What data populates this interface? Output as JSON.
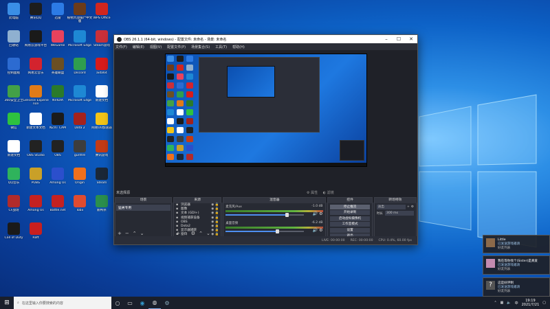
{
  "desktop_icons": [
    {
      "label": "此电脑",
      "color": "#3a8ee6"
    },
    {
      "label": "腾讯QQ",
      "color": "#1d1d1d"
    },
    {
      "label": "迅雷",
      "color": "#2c7be5"
    },
    {
      "label": "植物大战僵尸中文版",
      "color": "#6b3b1a"
    },
    {
      "label": "WPS Office",
      "color": "#d0261f"
    },
    {
      "label": "回收站",
      "color": "#8fb0d0"
    },
    {
      "label": "网易云游戏平台",
      "color": "#1a1a1a"
    },
    {
      "label": "WeGame",
      "color": "#e8425d"
    },
    {
      "label": "Microsoft Edge",
      "color": "#1e88d4"
    },
    {
      "label": "Steam游戏",
      "color": "#c9303a"
    },
    {
      "label": "控制面板",
      "color": "#2c6bd1"
    },
    {
      "label": "网易云音乐",
      "color": "#d3232e"
    },
    {
      "label": "英雄联盟",
      "color": "#6b4f23"
    },
    {
      "label": "Discord",
      "color": "#2f9e4e"
    },
    {
      "label": "aida64",
      "color": "#d81b1b"
    },
    {
      "label": "360安全卫士",
      "color": "#43a047"
    },
    {
      "label": "GeForce Experience",
      "color": "#e07b18"
    },
    {
      "label": "NVIDIA",
      "color": "#2a7a2a"
    },
    {
      "label": "Microsoft Edge",
      "color": "#1e88d4"
    },
    {
      "label": "新建文档",
      "color": "#ffffff"
    },
    {
      "label": "微信",
      "color": "#2ec23f"
    },
    {
      "label": "新建文本文档",
      "color": "#ffffff"
    },
    {
      "label": "NZXT CAM",
      "color": "#1b1b1b"
    },
    {
      "label": "Dota 2",
      "color": "#a3221c"
    },
    {
      "label": "网易UU加速器",
      "color": "#f2c417"
    },
    {
      "label": "新建文档",
      "color": "#ffffff"
    },
    {
      "label": "OBS Studio",
      "color": "#222"
    },
    {
      "label": "OBS",
      "color": "#222"
    },
    {
      "label": "gunfire",
      "color": "#3d3d3d"
    },
    {
      "label": "腾讯游戏",
      "color": "#c43b15"
    },
    {
      "label": "QQ音乐",
      "color": "#2fb35c"
    },
    {
      "label": "PUBG",
      "color": "#c9a028"
    },
    {
      "label": "Among Us",
      "color": "#2b4fcc"
    },
    {
      "label": "Origin",
      "color": "#f0701c"
    },
    {
      "label": "Steam",
      "color": "#1b2838"
    },
    {
      "label": "CF战场",
      "color": "#b12b2b"
    },
    {
      "label": "Among Us",
      "color": "#c42121"
    },
    {
      "label": "Battle.net",
      "color": "#c42121"
    },
    {
      "label": "Tobii",
      "color": "#e04b2f"
    },
    {
      "label": "鹅鸭杀",
      "color": "#2b8f4d"
    },
    {
      "label": "Call of Duty",
      "color": "#1a1a1a"
    },
    {
      "label": "Raft",
      "color": "#c81f1f"
    }
  ],
  "obs": {
    "title": "OBS 26.1.1 (64-bit, windows) - 配置文件: 未命名 - 场景: 未命名",
    "menu": [
      "文件(F)",
      "编辑(E)",
      "视图(V)",
      "配置文件(P)",
      "场景集合(S)",
      "工具(T)",
      "帮助(H)"
    ],
    "scene_label": "未选择源",
    "live_toggles": [
      "属性",
      "滤镜"
    ],
    "docks": {
      "scenes_title": "场景",
      "sources_title": "来源",
      "mixer_title": "混音器",
      "controls_title": "控件",
      "transitions_title": "转场特效"
    },
    "scenes": [
      "猛男专用"
    ],
    "sources": [
      "浏览器",
      "图像",
      "文本 (GDI+)",
      "视频捕获设备",
      "OBS",
      "Dota2",
      "显示器捕获",
      "窗口"
    ],
    "mixer": [
      {
        "name": "麦克风/Aux",
        "db": "-1.0 dB",
        "level": 0.78
      },
      {
        "name": "桌面音频",
        "db": "-6.2 dB",
        "level": 0.66
      }
    ],
    "controls": [
      "停止推流",
      "开始录制",
      "启动虚拟摄像机",
      "工作室模式",
      "设置",
      "退出"
    ],
    "transitions": {
      "type": "淡出",
      "duration_label": "时长",
      "duration": "300 ms"
    },
    "status": {
      "live": "LIVE: 00:00:00",
      "rec": "REC: 00:00:00",
      "cpu": "CPU: 0.4%, 60.00 fps"
    }
  },
  "notifications": [
    {
      "name": "Little",
      "line1": "已发送游戏邀请",
      "line2": "好友列表"
    },
    {
      "name": "我在等你找个(Sister)是真爱",
      "line1": "已发送游戏邀请",
      "line2": "好友列表"
    },
    {
      "name": "这是好评制",
      "line1": "已发送游戏邀请",
      "line2": "好友列表"
    }
  ],
  "taskbar": {
    "search_placeholder": "在这里输入你要搜索的内容",
    "time": "19:19",
    "date": "2021/7/21",
    "ime": "中"
  }
}
